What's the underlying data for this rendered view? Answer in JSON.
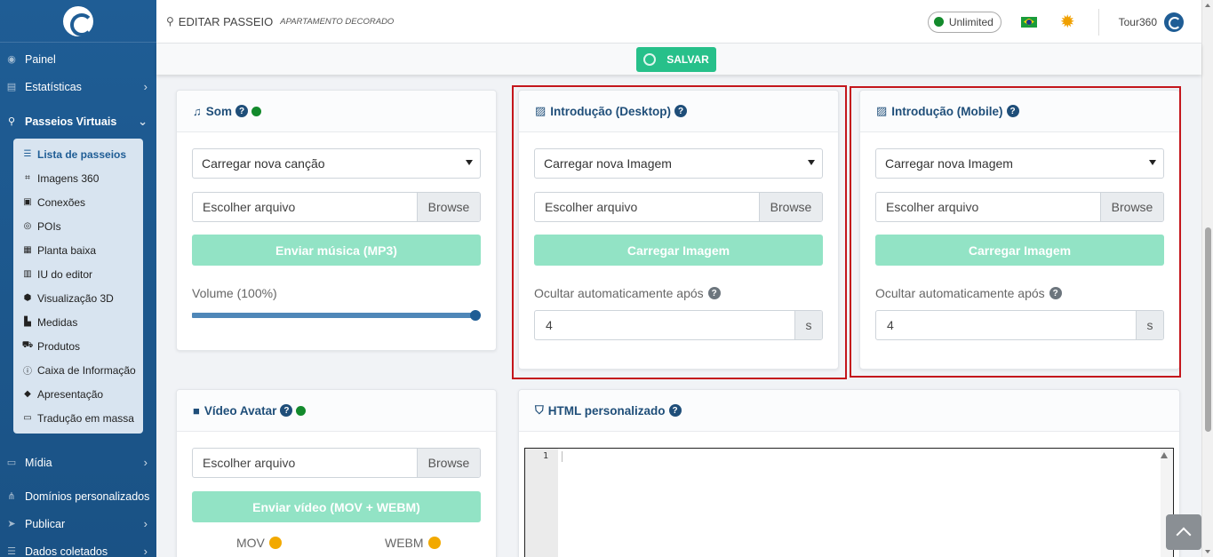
{
  "sidebar": {
    "items_top": [
      {
        "label": "Painel",
        "icon": "dashboard-icon"
      },
      {
        "label": "Estatísticas",
        "icon": "chart-icon",
        "chevron": "›"
      },
      {
        "label": "Passeios Virtuais",
        "icon": "route-icon",
        "chevron": "⌄"
      }
    ],
    "sub_items": [
      {
        "label": "Lista de passeios",
        "icon": "list-icon"
      },
      {
        "label": "Imagens 360",
        "icon": "panorama-icon"
      },
      {
        "label": "Conexões",
        "icon": "link-icon"
      },
      {
        "label": "POIs",
        "icon": "target-icon"
      },
      {
        "label": "Planta baixa",
        "icon": "map-icon"
      },
      {
        "label": "IU do editor",
        "icon": "editor-icon"
      },
      {
        "label": "Visualização 3D",
        "icon": "cube-icon"
      },
      {
        "label": "Medidas",
        "icon": "ruler-icon"
      },
      {
        "label": "Produtos",
        "icon": "cart-icon"
      },
      {
        "label": "Caixa de Informação",
        "icon": "info-icon"
      },
      {
        "label": "Apresentação",
        "icon": "presentation-icon"
      },
      {
        "label": "Tradução em massa",
        "icon": "translate-icon"
      }
    ],
    "items_bottom": [
      {
        "label": "Mídia",
        "icon": "monitor-icon",
        "chevron": "›"
      },
      {
        "label": "Domínios personalizados",
        "icon": "sitemap-icon"
      },
      {
        "label": "Publicar",
        "icon": "send-icon",
        "chevron": "›"
      },
      {
        "label": "Dados coletados",
        "icon": "database-icon",
        "chevron": "›"
      }
    ]
  },
  "topbar": {
    "title": "EDITAR PASSEIO",
    "subtitle": "APARTAMENTO DECORADO",
    "plan": "Unlimited",
    "plan_color": "#138a2c",
    "user": "Tour360"
  },
  "savebar": {
    "label": "SALVAR"
  },
  "som": {
    "title": "Som",
    "select": "Carregar nova canção",
    "file_placeholder": "Escolher arquivo",
    "browse": "Browse",
    "upload": "Enviar música (MP3)",
    "volume_label": "Volume (100%)",
    "volume": 100
  },
  "intro_desktop": {
    "title": "Introdução (Desktop)",
    "select": "Carregar nova Imagem",
    "file_placeholder": "Escolher arquivo",
    "browse": "Browse",
    "upload": "Carregar Imagem",
    "hide_label": "Ocultar automaticamente após",
    "hide_value": "4",
    "unit": "s"
  },
  "intro_mobile": {
    "title": "Introdução (Mobile)",
    "select": "Carregar nova Imagem",
    "file_placeholder": "Escolher arquivo",
    "browse": "Browse",
    "upload": "Carregar Imagem",
    "hide_label": "Ocultar automaticamente após",
    "hide_value": "4",
    "unit": "s"
  },
  "video_avatar": {
    "title": "Vídeo Avatar",
    "file_placeholder": "Escolher arquivo",
    "browse": "Browse",
    "upload": "Enviar vídeo (MOV + WEBM)",
    "fmt_mov": "MOV",
    "fmt_webm": "WEBM"
  },
  "html_custom": {
    "title": "HTML personalizado",
    "line_number": "1"
  },
  "help_mark": "?"
}
